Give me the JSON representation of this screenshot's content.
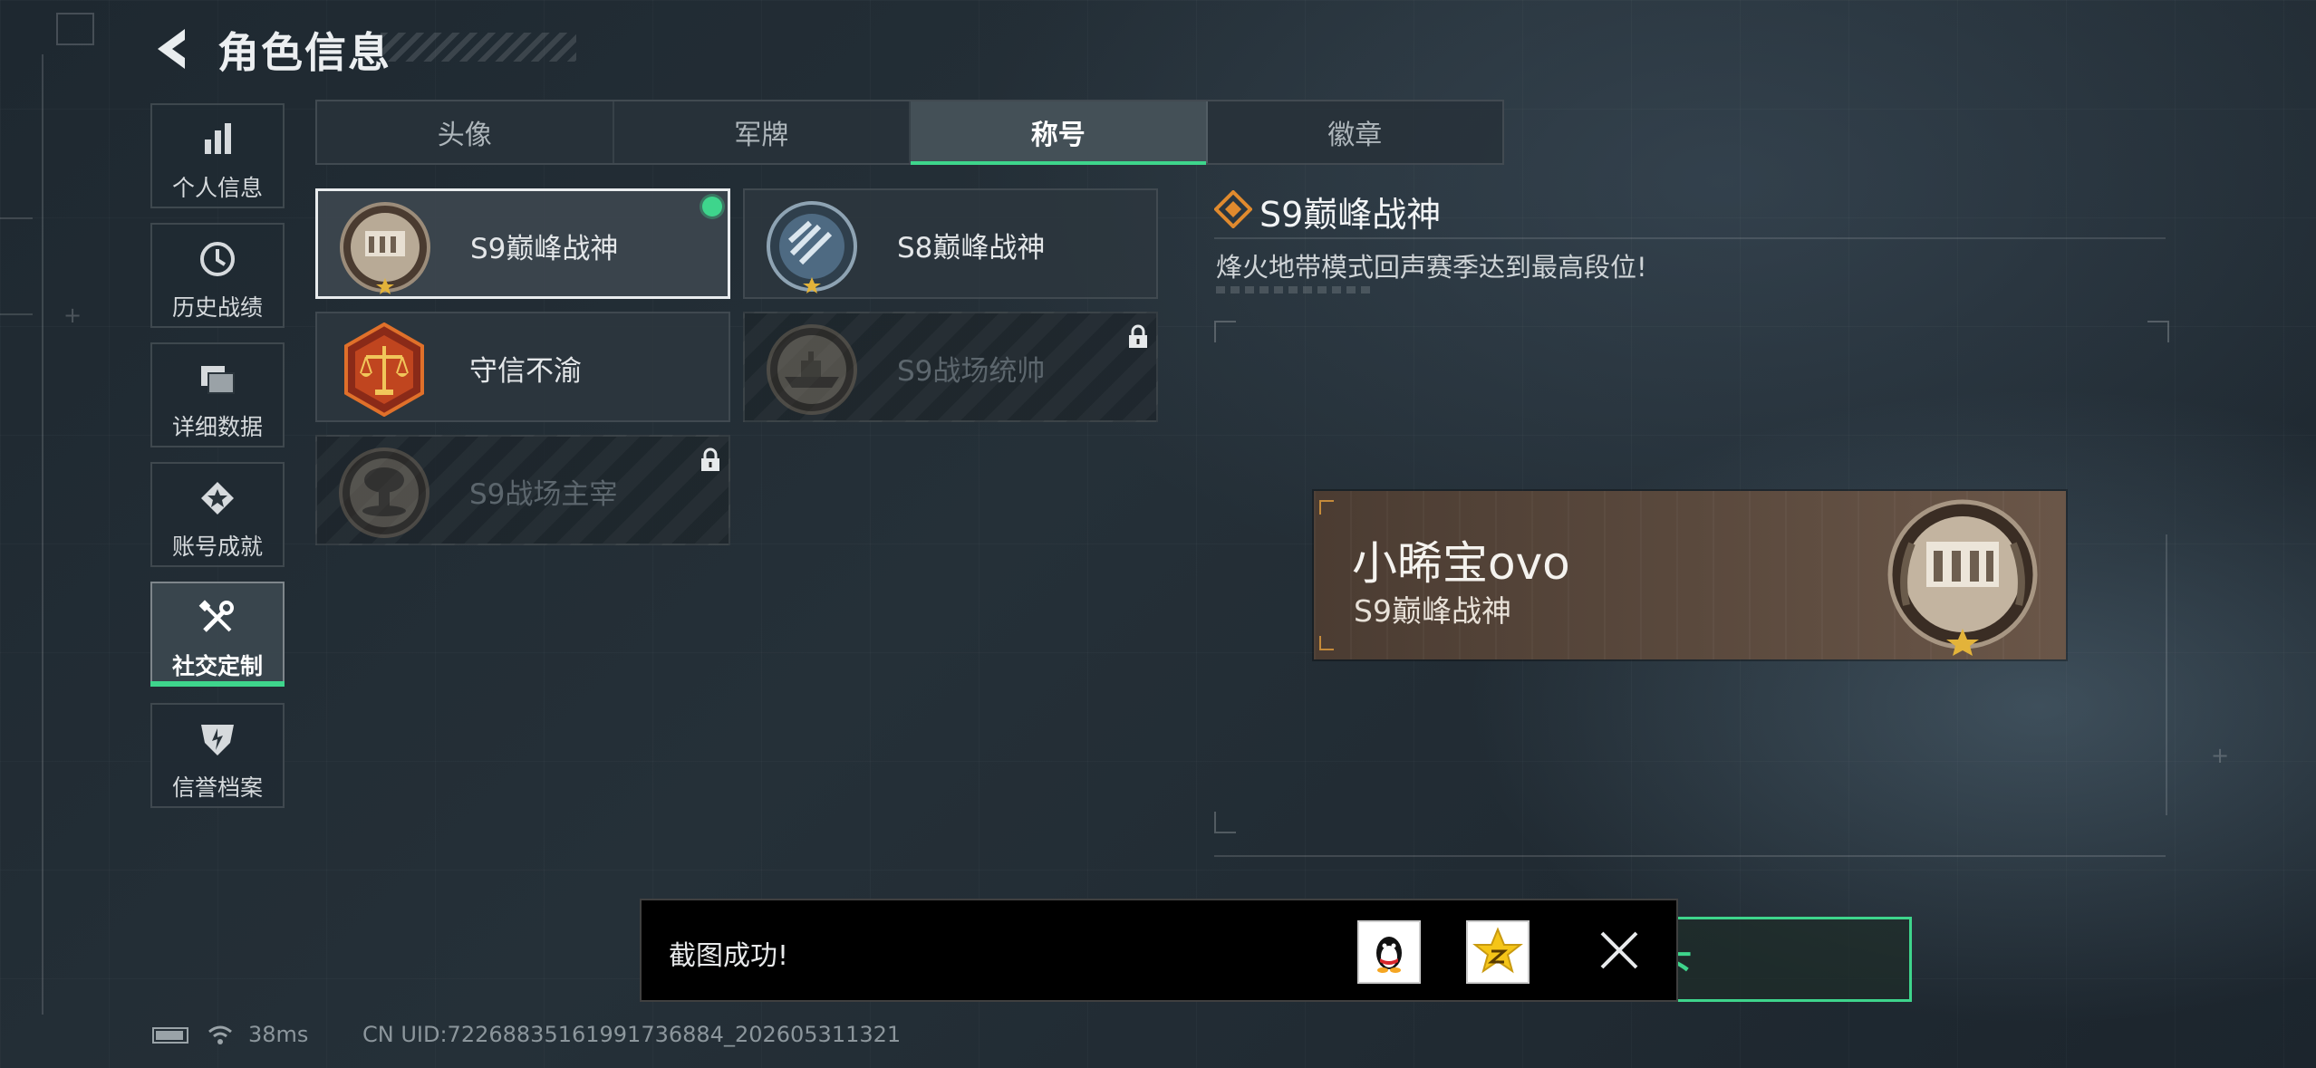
{
  "header": {
    "title": "角色信息"
  },
  "sidebar": {
    "items": [
      {
        "label": "个人信息",
        "icon": "bar-chart-icon"
      },
      {
        "label": "历史战绩",
        "icon": "clock-icon"
      },
      {
        "label": "详细数据",
        "icon": "folder-icon"
      },
      {
        "label": "账号成就",
        "icon": "medal-icon"
      },
      {
        "label": "社交定制",
        "icon": "tools-icon",
        "active": true
      },
      {
        "label": "信誉档案",
        "icon": "shield-icon"
      }
    ]
  },
  "tabs": [
    {
      "label": "头像"
    },
    {
      "label": "军牌"
    },
    {
      "label": "称号",
      "active": true
    },
    {
      "label": "徽章"
    }
  ],
  "titles": [
    {
      "label": "S9巅峰战神",
      "selected": true,
      "equipped": true,
      "locked": false
    },
    {
      "label": "S8巅峰战神",
      "selected": false,
      "equipped": false,
      "locked": false
    },
    {
      "label": "守信不渝",
      "selected": false,
      "equipped": false,
      "locked": false
    },
    {
      "label": "S9战场统帅",
      "selected": false,
      "equipped": false,
      "locked": true
    },
    {
      "label": "S9战场主宰",
      "selected": false,
      "equipped": false,
      "locked": true
    }
  ],
  "detail": {
    "title": "S9巅峰战神",
    "description": "烽火地带模式回声赛季达到最高段位!"
  },
  "plate": {
    "player_name": "小晞宝ovo",
    "title": "S9巅峰战神"
  },
  "confirm_button": {
    "label_partial": "卸下"
  },
  "toast": {
    "message": "截图成功!",
    "share_qq_icon": "qq-penguin-icon",
    "share_qzone_icon": "qzone-star-icon"
  },
  "status": {
    "ping": "38ms",
    "uid": "CN UID:7226883516199173688​4_202605311321"
  },
  "colors": {
    "accent": "#3ed58c",
    "plate": "#5a493d"
  }
}
